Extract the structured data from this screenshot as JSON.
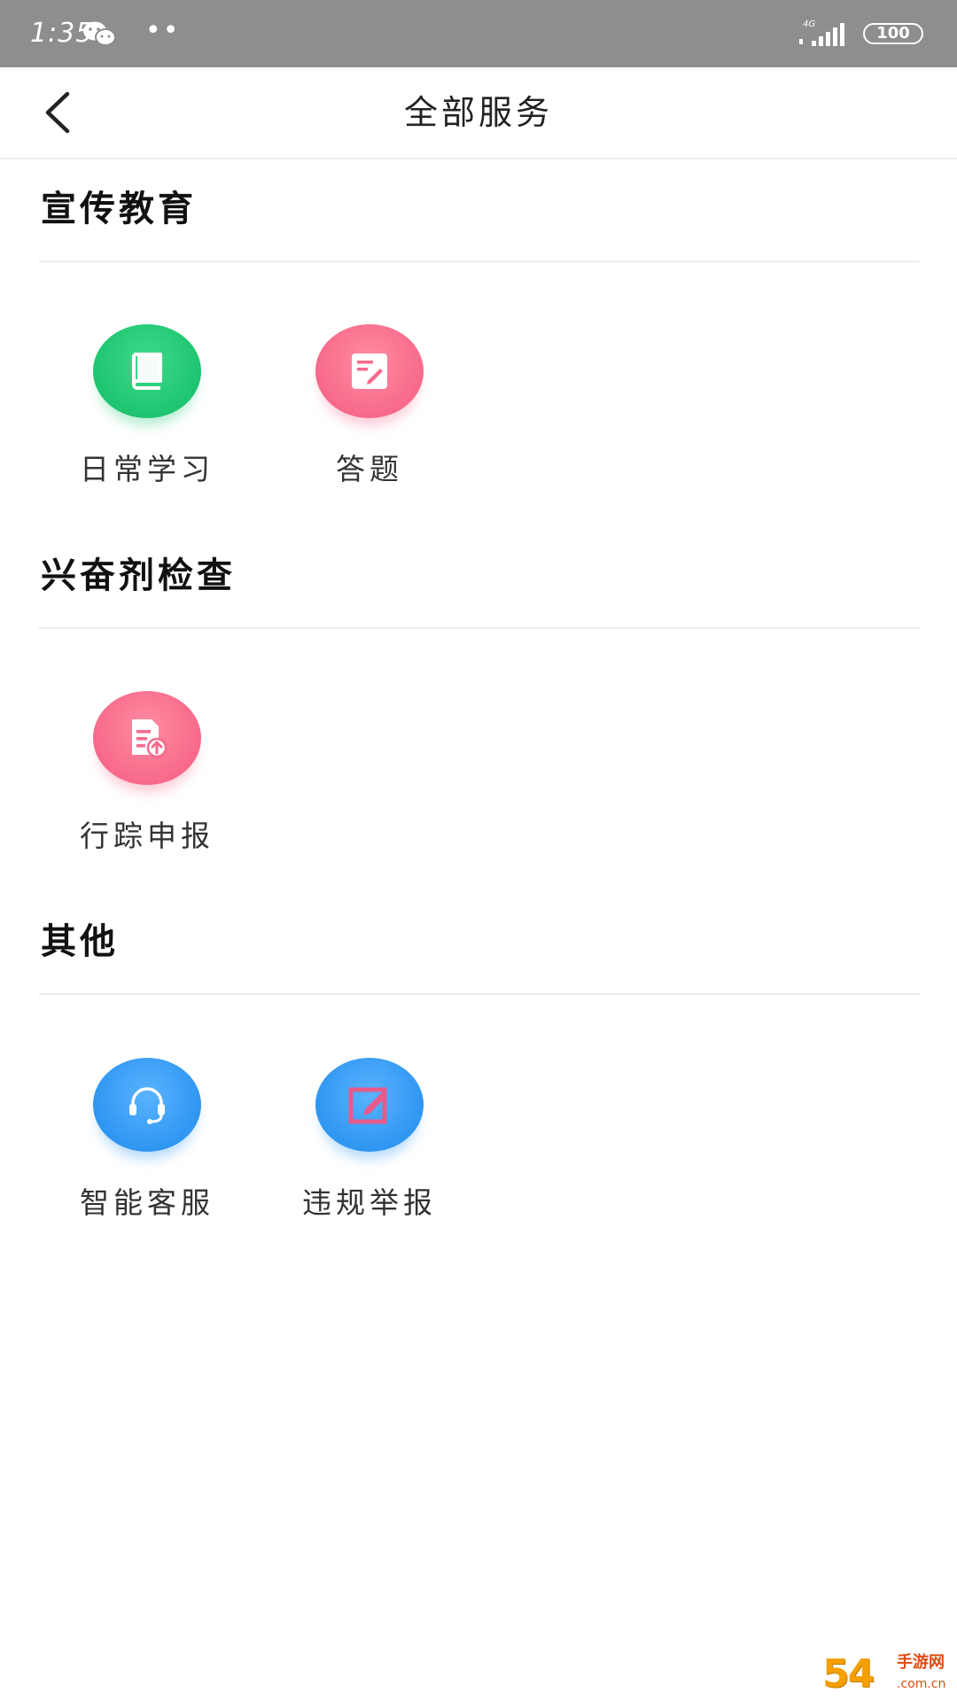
{
  "status_bar": {
    "time": "1:35",
    "dots": "••",
    "network": "4G",
    "battery": "100"
  },
  "header": {
    "title": "全部服务"
  },
  "sections": [
    {
      "heading": "宣传教育",
      "items": [
        {
          "label": "日常学习",
          "icon": "book-icon",
          "color": "#22c776"
        },
        {
          "label": "答题",
          "icon": "edit-note-icon",
          "color": "#f7728f"
        }
      ]
    },
    {
      "heading": "兴奋剂检查",
      "items": [
        {
          "label": "行踪申报",
          "icon": "document-upload-icon",
          "color": "#f7728f"
        }
      ]
    },
    {
      "heading": "其他",
      "items": [
        {
          "label": "智能客服",
          "icon": "headset-icon",
          "color": "#3399f3"
        },
        {
          "label": "违规举报",
          "icon": "report-edit-icon",
          "color": "#3399f3"
        }
      ]
    }
  ],
  "watermark": {
    "main": "54",
    "text": "手游网",
    "sub": ".com.cn"
  }
}
